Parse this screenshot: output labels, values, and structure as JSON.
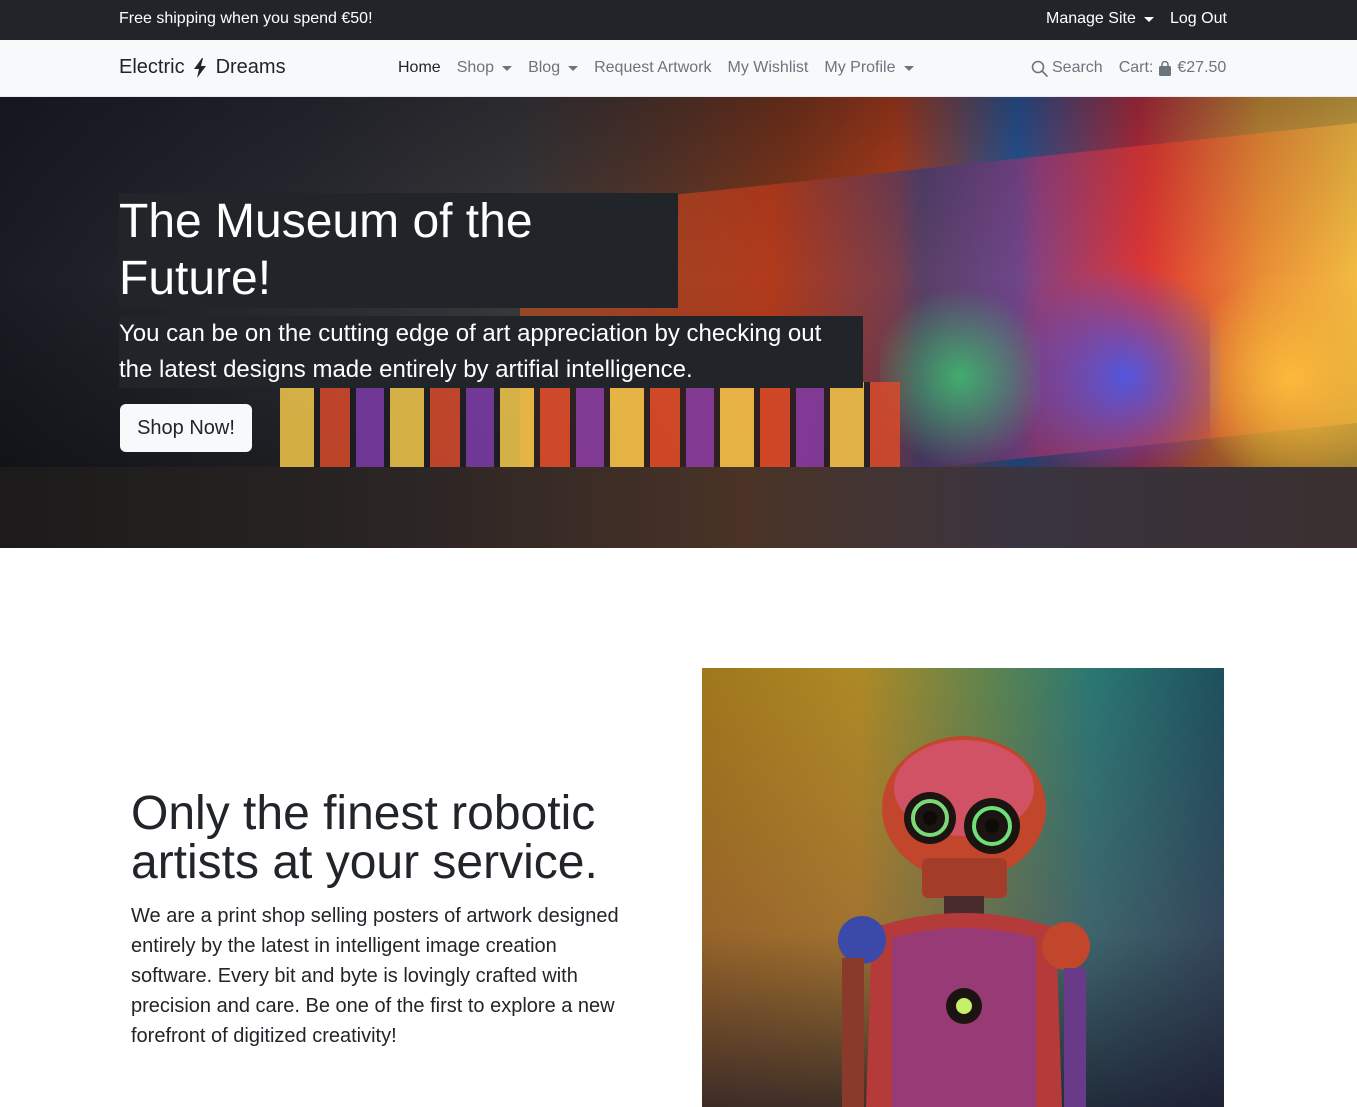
{
  "topbar": {
    "promo": "Free shipping when you spend €50!",
    "manage_site": "Manage Site",
    "logout": "Log Out"
  },
  "navbar": {
    "brand_left": "Electric",
    "brand_right": "Dreams",
    "links": [
      {
        "label": "Home",
        "active": true
      },
      {
        "label": "Shop",
        "dropdown": true
      },
      {
        "label": "Blog",
        "dropdown": true
      },
      {
        "label": "Request Artwork"
      },
      {
        "label": "My Wishlist"
      },
      {
        "label": "My Profile",
        "dropdown": true
      }
    ],
    "search": "Search",
    "cart_label": "Cart:",
    "cart_total": "€27.50"
  },
  "hero": {
    "title": "The Museum of the Future!",
    "subtitle": "You can be on the cutting edge of art appreciation by checking out the latest designs made entirely by artifial intelligence.",
    "cta": "Shop Now!"
  },
  "about": {
    "title": "Only the finest robotic artists at your service.",
    "body": "We are a print shop selling posters of artwork designed entirely by the latest in intelligent image creation software. Every bit and byte is lovingly crafted with precision and care. Be one of the first to explore a new forefront of digitized creativity!"
  },
  "icons": {
    "brand": "lightning-bolt-icon",
    "search": "search-icon",
    "cart": "shopping-bag-icon",
    "dropdown": "caret-down-icon"
  },
  "colors": {
    "dark": "#212529",
    "light": "#f8f9fa",
    "muted": "#6c757d"
  }
}
